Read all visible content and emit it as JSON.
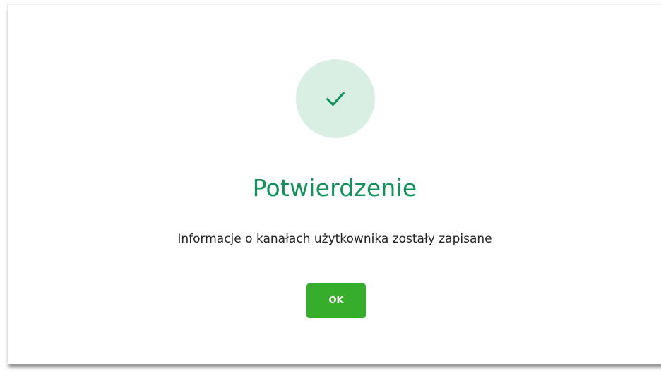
{
  "dialog": {
    "title": "Potwierdzenie",
    "message": "Informacje o kanałach użytkownika zostały zapisane",
    "ok_label": "OK",
    "icon": "check-icon"
  },
  "colors": {
    "accent_green": "#12925a",
    "icon_circle_bg": "#d9efe4",
    "button_bg": "#36ad2b",
    "button_text": "#ffffff",
    "message_text": "#222222"
  }
}
